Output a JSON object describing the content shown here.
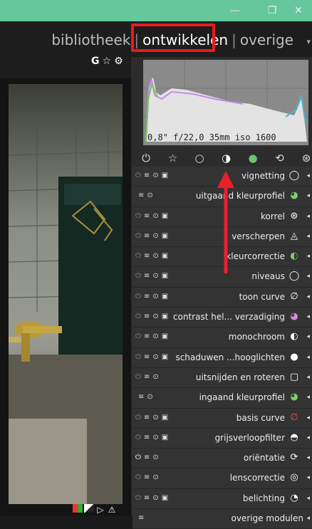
{
  "window": {
    "minimize_glyph": "—",
    "maximize_glyph": "❐",
    "close_glyph": "✕",
    "accent": "#66c79a"
  },
  "nav": {
    "items": [
      {
        "label": "bibliotheek",
        "active": false
      },
      {
        "label": "ontwikkelen",
        "active": true
      },
      {
        "label": "overige",
        "active": false
      }
    ],
    "separator": "|",
    "expand_glyph": "▾",
    "highlight_color": "#e81b1b"
  },
  "quick": {
    "g_label": "G",
    "star_glyph": "☆",
    "gear_glyph": "⚙"
  },
  "histogram": {
    "info": "0,8\" f/22,0 35mm iso 1600"
  },
  "groups": [
    {
      "name": "power-icon",
      "glyph": "⏻"
    },
    {
      "name": "star-icon",
      "glyph": "☆"
    },
    {
      "name": "circle-icon",
      "glyph": "○"
    },
    {
      "name": "half-circle-icon",
      "glyph": "◑"
    },
    {
      "name": "color-icon",
      "glyph": "●"
    },
    {
      "name": "correct-icon",
      "glyph": "⟲"
    },
    {
      "name": "effect-icon",
      "glyph": "⊛"
    }
  ],
  "modules": [
    {
      "label": "vignetting",
      "icon": "vignette-icon",
      "glyph": "◯",
      "power": "⏻",
      "menu": "≡",
      "preset": "⊙",
      "copy": "▣",
      "on": false
    },
    {
      "label": "uitgaand kleurprofiel",
      "icon": "color-profile-icon",
      "glyph": "◕",
      "power": "",
      "menu": "≡",
      "preset": "⊙",
      "copy": "",
      "on": false
    },
    {
      "label": "korrel",
      "icon": "grain-icon",
      "glyph": "⊛",
      "power": "⏻",
      "menu": "≡",
      "preset": "⊙",
      "copy": "▣",
      "on": false
    },
    {
      "label": "verscherpen",
      "icon": "sharpen-icon",
      "glyph": "◬",
      "power": "⏻",
      "menu": "≡",
      "preset": "⊙",
      "copy": "▣",
      "on": false
    },
    {
      "label": "kleurcorrectie",
      "icon": "color-correction-icon",
      "glyph": "◐",
      "power": "⏻",
      "menu": "≡",
      "preset": "⊙",
      "copy": "▣",
      "on": false
    },
    {
      "label": "niveaus",
      "icon": "levels-icon",
      "glyph": "◯",
      "power": "⏻",
      "menu": "≡",
      "preset": "⊙",
      "copy": "▣",
      "on": false
    },
    {
      "label": "toon curve",
      "icon": "tone-curve-icon",
      "glyph": "∅",
      "power": "⏻",
      "menu": "≡",
      "preset": "⊙",
      "copy": "▣",
      "on": false
    },
    {
      "label": "contrast hel... verzadiging",
      "icon": "contrast-icon",
      "glyph": "◕",
      "power": "⏻",
      "menu": "≡",
      "preset": "⊙",
      "copy": "▣",
      "on": false
    },
    {
      "label": "monochroom",
      "icon": "monochrome-icon",
      "glyph": "◐",
      "power": "⏻",
      "menu": "≡",
      "preset": "⊙",
      "copy": "▣",
      "on": false
    },
    {
      "label": "schaduwen ...hooglichten",
      "icon": "shadows-icon",
      "glyph": "●",
      "power": "⏻",
      "menu": "≡",
      "preset": "⊙",
      "copy": "▣",
      "on": false
    },
    {
      "label": "uitsnijden en roteren",
      "icon": "crop-icon",
      "glyph": "▢",
      "power": "⏻",
      "menu": "≡",
      "preset": "⊙",
      "copy": "",
      "on": false
    },
    {
      "label": "ingaand kleurprofiel",
      "icon": "input-profile-icon",
      "glyph": "◕",
      "power": "",
      "menu": "≡",
      "preset": "⊙",
      "copy": "",
      "on": false
    },
    {
      "label": "basis curve",
      "icon": "base-curve-icon",
      "glyph": "∅",
      "power": "⏻",
      "menu": "≡",
      "preset": "⊙",
      "copy": "▣",
      "on": false
    },
    {
      "label": "grijsverloopfilter",
      "icon": "gradient-filter-icon",
      "glyph": "◓",
      "power": "⏻",
      "menu": "≡",
      "preset": "⊙",
      "copy": "▣",
      "on": false
    },
    {
      "label": "oriëntatie",
      "icon": "orientation-icon",
      "glyph": "⟳",
      "power": "⏻",
      "menu": "≡",
      "preset": "⊙",
      "copy": "",
      "on": true
    },
    {
      "label": "lenscorrectie",
      "icon": "lens-icon",
      "glyph": "◎",
      "power": "⏻",
      "menu": "≡",
      "preset": "⊙",
      "copy": "",
      "on": false
    },
    {
      "label": "belichting",
      "icon": "exposure-icon",
      "glyph": "◔",
      "power": "⏻",
      "menu": "≡",
      "preset": "⊙",
      "copy": "▣",
      "on": false
    },
    {
      "label": "overige modulen",
      "icon": "",
      "glyph": "",
      "power": "",
      "menu": "≡",
      "preset": "",
      "copy": "",
      "on": false
    }
  ],
  "module_arrow": "◂"
}
